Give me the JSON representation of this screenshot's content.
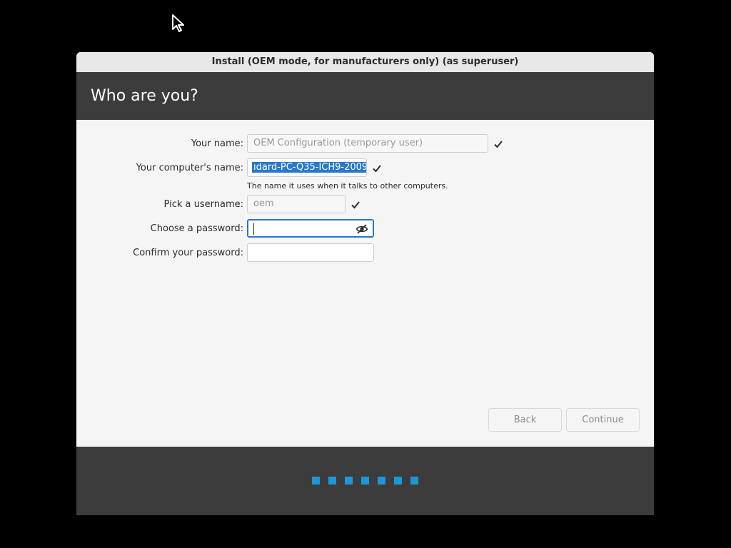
{
  "window": {
    "title": "Install (OEM mode, for manufacturers only) (as superuser)",
    "header": "Who are you?"
  },
  "form": {
    "your_name_label": "Your name:",
    "your_name_value": "OEM Configuration (temporary user)",
    "computer_name_label": "Your computer's name:",
    "computer_name_value": "ıdard-PC-Q35-ICH9-2009",
    "computer_name_hint": "The name it uses when it talks to other computers.",
    "username_label": "Pick a username:",
    "username_value": "oem",
    "password_label": "Choose a password:",
    "password_value": "",
    "confirm_label": "Confirm your password:",
    "confirm_value": ""
  },
  "buttons": {
    "back": "Back",
    "continue": "Continue"
  },
  "progress": {
    "dots": 7,
    "color": "#1e96d8"
  },
  "icons": {
    "cursor": "mouse-pointer-icon",
    "check": "checkmark-icon",
    "eye": "eye-slash-icon"
  }
}
